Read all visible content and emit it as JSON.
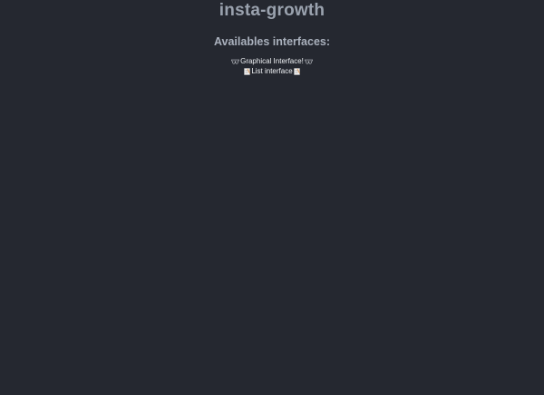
{
  "header": {
    "title": "insta-growth"
  },
  "main": {
    "subtitle": "Availables interfaces:",
    "links": [
      {
        "label": "Graphical Interface!",
        "icon_left": "sunglasses-icon",
        "icon_right": "sunglasses-icon"
      },
      {
        "label": "List interface",
        "icon_left": "memo-icon",
        "icon_right": "memo-icon"
      }
    ]
  },
  "colors": {
    "background": "#252830",
    "title": "#9aa2ae",
    "subtitle": "#aab1bd",
    "link_text": "#eef0f3"
  }
}
